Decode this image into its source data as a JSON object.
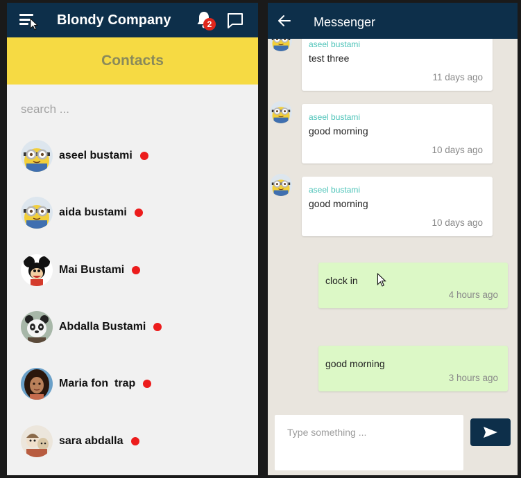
{
  "colors": {
    "header_bg": "#0d2f4a",
    "contacts_banner": "#f6da43",
    "online_dot": "#ec1c1c",
    "incoming_bubble": "#ffffff",
    "outgoing_bubble": "#dcf8c6",
    "sender_name": "#4cc3b8",
    "badge": "#e0261c"
  },
  "left": {
    "brand": "Blondy Company",
    "notification_count": "2",
    "icons": [
      "menu-icon",
      "bell-icon",
      "chat-bubble-icon"
    ],
    "contacts_title": "Contacts",
    "search_placeholder": "search ...",
    "contacts": [
      {
        "name": "aseel bustami",
        "avatar": "minion-avatar",
        "online": true
      },
      {
        "name": "aida bustami",
        "avatar": "minion-avatar",
        "online": true
      },
      {
        "name": "Mai Bustami",
        "avatar": "mickey-avatar",
        "online": true
      },
      {
        "name": "Abdalla Bustami",
        "avatar": "panda-avatar",
        "online": true
      },
      {
        "name": "Maria fon  trap",
        "avatar": "moana-avatar",
        "online": true
      },
      {
        "name": "sara abdalla",
        "avatar": "cartoon-avatar",
        "online": true
      }
    ]
  },
  "right": {
    "title": "Messenger",
    "icons": [
      "back-arrow-icon",
      "send-icon"
    ],
    "messages": [
      {
        "direction": "in",
        "sender": "aseel bustami",
        "text": "test three",
        "time": "11 days ago"
      },
      {
        "direction": "in",
        "sender": "aseel bustami",
        "text": "good morning",
        "time": "10 days ago"
      },
      {
        "direction": "in",
        "sender": "aseel bustami",
        "text": "good morning",
        "time": "10 days ago"
      },
      {
        "direction": "out",
        "text": "clock in",
        "time": "4 hours ago"
      },
      {
        "direction": "out",
        "text": "good morning",
        "time": "3 hours ago"
      }
    ],
    "composer_placeholder": "Type something ..."
  }
}
